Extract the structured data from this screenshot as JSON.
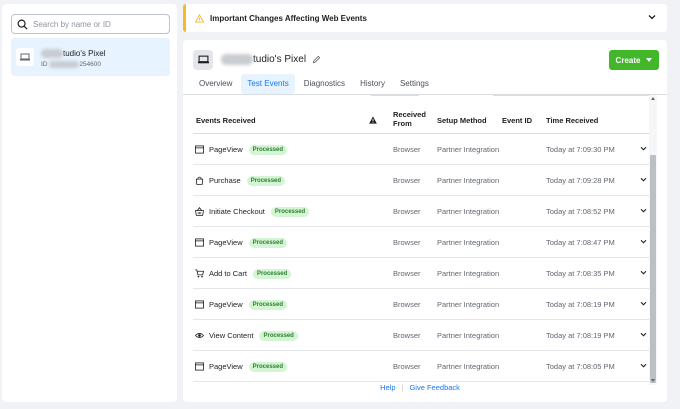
{
  "sidebar": {
    "search_placeholder": "Search by name or ID",
    "pixel": {
      "name_suffix": "tudio's Pixel",
      "id_prefix": "ID",
      "id_suffix": "254600"
    }
  },
  "alert": {
    "text": "Important Changes Affecting Web Events",
    "color": "#f7b928"
  },
  "header": {
    "title_suffix": "tudio's Pixel",
    "create_label": "Create"
  },
  "tabs": [
    {
      "label": "Overview",
      "active": false
    },
    {
      "label": "Test Events",
      "active": true
    },
    {
      "label": "Diagnostics",
      "active": false
    },
    {
      "label": "History",
      "active": false
    },
    {
      "label": "Settings",
      "active": false
    }
  ],
  "table": {
    "columns": {
      "events_received": "Events Received",
      "received_from_1": "Received",
      "received_from_2": "From",
      "setup_method": "Setup Method",
      "event_id": "Event ID",
      "time_received": "Time Received"
    },
    "rows": [
      {
        "event": "PageView",
        "icon": "page-icon",
        "status": "Processed",
        "from": "Browser",
        "setup": "Partner Integration",
        "event_id": "",
        "time": "Today at 7:09:30 PM"
      },
      {
        "event": "Purchase",
        "icon": "bag-icon",
        "status": "Processed",
        "from": "Browser",
        "setup": "Partner Integration",
        "event_id": "",
        "time": "Today at 7:09:28 PM"
      },
      {
        "event": "Initiate Checkout",
        "icon": "basket-icon",
        "status": "Processed",
        "from": "Browser",
        "setup": "Partner Integration",
        "event_id": "",
        "time": "Today at 7:08:52 PM"
      },
      {
        "event": "PageView",
        "icon": "page-icon",
        "status": "Processed",
        "from": "Browser",
        "setup": "Partner Integration",
        "event_id": "",
        "time": "Today at 7:08:47 PM"
      },
      {
        "event": "Add to Cart",
        "icon": "cart-icon",
        "status": "Processed",
        "from": "Browser",
        "setup": "Partner Integration",
        "event_id": "",
        "time": "Today at 7:08:35 PM"
      },
      {
        "event": "PageView",
        "icon": "page-icon",
        "status": "Processed",
        "from": "Browser",
        "setup": "Partner Integration",
        "event_id": "",
        "time": "Today at 7:08:19 PM"
      },
      {
        "event": "View Content",
        "icon": "eye-icon",
        "status": "Processed",
        "from": "Browser",
        "setup": "Partner Integration",
        "event_id": "",
        "time": "Today at 7:08:19 PM"
      },
      {
        "event": "PageView",
        "icon": "page-icon",
        "status": "Processed",
        "from": "Browser",
        "setup": "Partner Integration",
        "event_id": "",
        "time": "Today at 7:08:05 PM"
      }
    ]
  },
  "footer": {
    "help": "Help",
    "separator": "|",
    "feedback": "Give Feedback"
  },
  "colors": {
    "accent": "#1877f2",
    "create": "#42b72a",
    "badge_bg": "#d4f5d4",
    "badge_text": "#2e7d32"
  }
}
